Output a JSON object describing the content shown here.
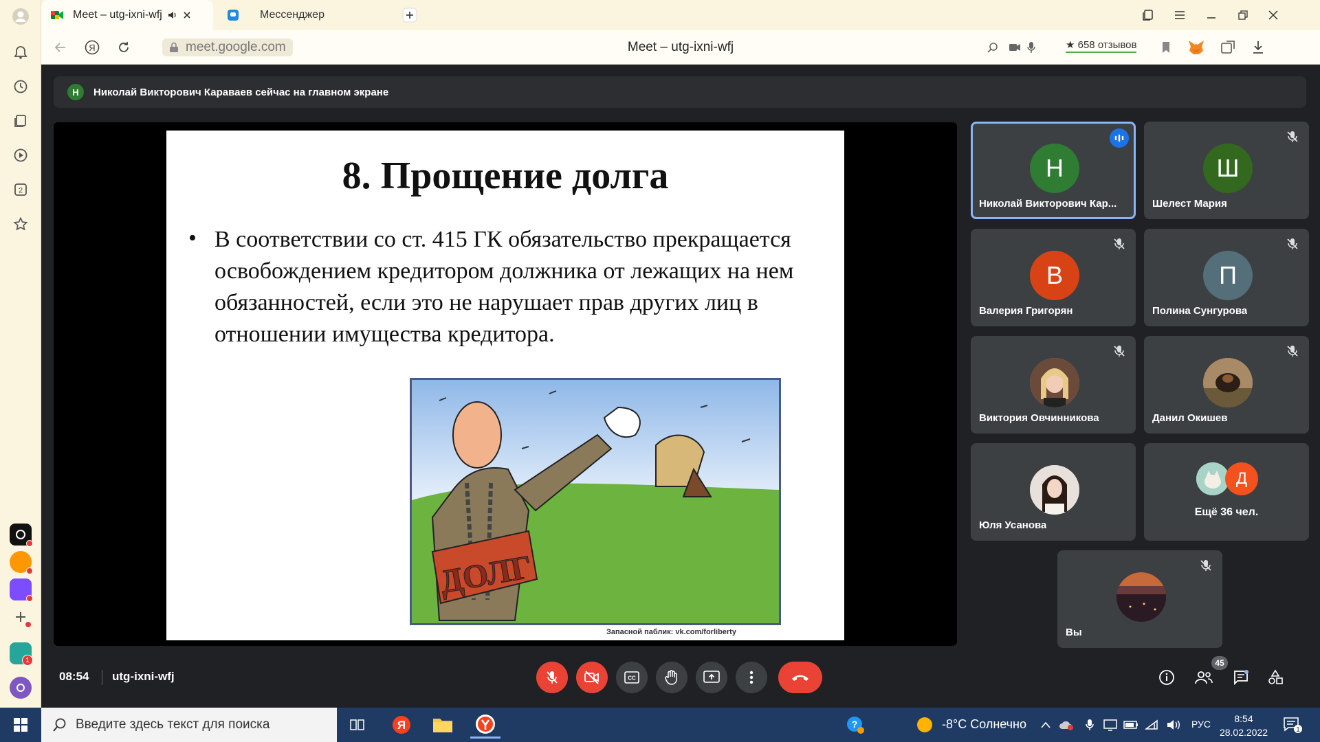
{
  "browser": {
    "tabs": [
      {
        "title": "Meet – utg-ixni-wfj",
        "active": true
      },
      {
        "title": "Мессенджер",
        "active": false
      }
    ],
    "url": "meet.google.com",
    "page_title": "Meet – utg-ixni-wfj",
    "reviews": "658 отзывов",
    "rail_badge": "1"
  },
  "meet": {
    "banner_initial": "Н",
    "banner_text": "Николай Викторович Караваев сейчас на главном экране",
    "slide": {
      "title": "8. Прощение долга",
      "bullet": "•",
      "body": "В соответствии со ст. 415 ГК обязательство прекращается освобождением кредитором должника от лежащих на нем обязанностей, если это не нарушает прав других лиц в отношении имущества кредитора.",
      "cartoon_text": "ДОЛГ",
      "caption": "Запасной паблик: vk.com/forliberty"
    },
    "participants": [
      {
        "name": "Николай Викторович Кар...",
        "initial": "Н",
        "color": "#2e7d32",
        "speaking": true
      },
      {
        "name": "Шелест Мария",
        "initial": "Ш",
        "color": "#33691e",
        "muted": true
      },
      {
        "name": "Валерия Григорян",
        "initial": "В",
        "color": "#d84315",
        "muted": true
      },
      {
        "name": "Полина Сунгурова",
        "initial": "П",
        "color": "#546e7a",
        "muted": true
      },
      {
        "name": "Виктория Овчинникова",
        "initial": "",
        "color": "#c9a58a",
        "muted": true
      },
      {
        "name": "Данил Окишев",
        "initial": "",
        "color": "#8a6d4e",
        "muted": true
      },
      {
        "name": "Юля Усанова",
        "initial": "",
        "color": "#d8cfc8",
        "muted": false
      }
    ],
    "more": {
      "initial": "Д",
      "label": "Ещё 36 чел."
    },
    "self": {
      "name": "Вы"
    },
    "time": "08:54",
    "meeting_code": "utg-ixni-wfj",
    "participant_count": "45"
  },
  "taskbar": {
    "search_placeholder": "Введите здесь текст для поиска",
    "weather": "-8°C  Солнечно",
    "lang": "РУС",
    "time": "8:54",
    "date": "28.02.2022",
    "notifications": "1"
  }
}
